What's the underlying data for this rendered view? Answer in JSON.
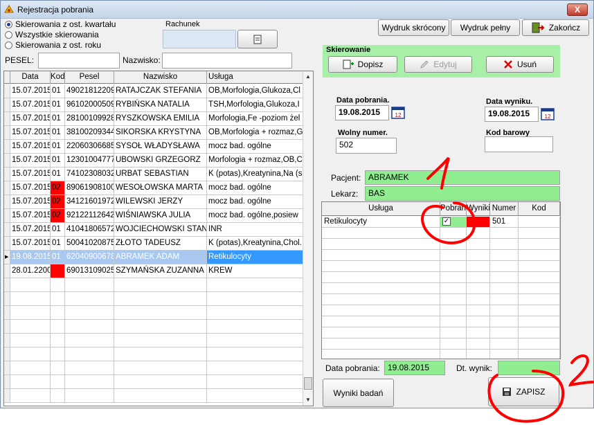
{
  "window": {
    "title": "Rejestracja pobrania",
    "close_label": "X"
  },
  "filters": {
    "options": [
      "Skierowania z ost. kwartału",
      "Wszystkie skierowania",
      "Skierowania z ost. roku"
    ],
    "selected_index": 0
  },
  "rachunek": {
    "label": "Rachunek",
    "value": ""
  },
  "toolbar": {
    "print_short": "Wydruk skrócony",
    "print_full": "Wydruk pełny",
    "finish": "Zakończ"
  },
  "search": {
    "pesel_label": "PESEL:",
    "pesel_value": "",
    "surname_label": "Nazwisko:",
    "surname_value": ""
  },
  "list": {
    "columns": [
      "Data",
      "Kod",
      "Pesel",
      "Nazwisko",
      "Usługa"
    ],
    "rows": [
      {
        "data": "15.07.2015",
        "kod": "01",
        "pesel": "49021812209",
        "nazwisko": "RATAJCZAK STEFANIA",
        "usluga": "OB,Morfologia,Glukoza,Cl",
        "kod_red": false
      },
      {
        "data": "15.07.2015",
        "kod": "01",
        "pesel": "96102000509",
        "nazwisko": "RYBIŃSKA NATALIA",
        "usluga": "TSH,Morfologia,Glukoza,I",
        "kod_red": false
      },
      {
        "data": "15.07.2015",
        "kod": "01",
        "pesel": "28100109928",
        "nazwisko": "RYSZKOWSKA EMILIA",
        "usluga": "Morfologia,Fe -poziom żel",
        "kod_red": false
      },
      {
        "data": "15.07.2015",
        "kod": "01",
        "pesel": "38100209344",
        "nazwisko": "SIKORSKA KRYSTYNA",
        "usluga": "OB,Morfologia + rozmaz,G",
        "kod_red": false
      },
      {
        "data": "15.07.2015",
        "kod": "01",
        "pesel": "22060306685",
        "nazwisko": "SYSOŁ WŁADYSŁAWA",
        "usluga": "mocz bad. ogólne",
        "kod_red": false
      },
      {
        "data": "15.07.2015",
        "kod": "01",
        "pesel": "12301004777",
        "nazwisko": "UBOWSKI GRZEGORZ",
        "usluga": "Morfologia + rozmaz,OB,C",
        "kod_red": false
      },
      {
        "data": "15.07.2015",
        "kod": "01",
        "pesel": "74102308032",
        "nazwisko": "URBAT SEBASTIAN",
        "usluga": "K (potas),Kreatynina,Na (s",
        "kod_red": false
      },
      {
        "data": "15.07.2015",
        "kod": "02",
        "pesel": "89061908100",
        "nazwisko": "WESOŁOWSKA MARTA",
        "usluga": "mocz bad. ogólne",
        "kod_red": true
      },
      {
        "data": "15.07.2015",
        "kod": "02",
        "pesel": "34121601972",
        "nazwisko": "WILEWSKI JERZY",
        "usluga": "mocz bad. ogólne",
        "kod_red": true
      },
      {
        "data": "15.07.2015",
        "kod": "02",
        "pesel": "92122112642",
        "nazwisko": "WIŚNIAWSKA JULIA",
        "usluga": "mocz bad. ogólne,posiew",
        "kod_red": true
      },
      {
        "data": "15.07.2015",
        "kod": "01",
        "pesel": "41041806572",
        "nazwisko": "WOJCIECHOWSKI STANIS",
        "usluga": "INR",
        "kod_red": false
      },
      {
        "data": "15.07.2015",
        "kod": "01",
        "pesel": "50041020875",
        "nazwisko": "ZŁOTO TADEUSZ",
        "usluga": "K (potas),Kreatynina,Chol.",
        "kod_red": false
      },
      {
        "data": "19.08.2015",
        "kod": "01",
        "pesel": "62040900678",
        "nazwisko": "ABRAMEK ADAM",
        "usluga": "Retikulocyty",
        "kod_red": false,
        "selected": true
      },
      {
        "data": "28.01.2200",
        "kod": "",
        "pesel": "69013109025",
        "nazwisko": "SZYMAŃSKA ZUZANNA",
        "usluga": "KREW",
        "kod_red": true
      }
    ]
  },
  "skierowanie": {
    "title": "Skierowanie",
    "add": "Dopisz",
    "edit": "Edytuj",
    "delete": "Usuń"
  },
  "form": {
    "data_pobrania_label": "Data pobrania.",
    "data_pobrania": "19.08.2015",
    "data_wyniku_label": "Data wyniku.",
    "data_wyniku": "19.08.2015",
    "wolny_numer_label": "Wolny numer.",
    "wolny_numer": "502",
    "kod_barowy_label": "Kod barowy",
    "kod_barowy": "",
    "pacjent_label": "Pacjent:",
    "pacjent": "ABRAMEK",
    "lekarz_label": "Lekarz:",
    "lekarz": "BAS"
  },
  "services": {
    "columns": [
      "Usługa",
      "Pobrani",
      "Wyniki",
      "Numer",
      "Kod"
    ],
    "rows": [
      {
        "usluga": "Retikulocyty",
        "pobrani": true,
        "numer": "501",
        "kod": ""
      }
    ]
  },
  "bottom": {
    "data_pobrania_label": "Data pobrania:",
    "data_pobrania": "19.08.2015",
    "dt_wynik_label": "Dt. wynik:",
    "dt_wynik": "",
    "wyniki_button": "Wyniki badań",
    "save_button": "ZAPISZ"
  },
  "annotations": [
    "1",
    "2"
  ],
  "colors": {
    "green": "#90ee90",
    "red": "#ff0000",
    "selection": "#3399ff",
    "annotation": "#ff0000"
  }
}
